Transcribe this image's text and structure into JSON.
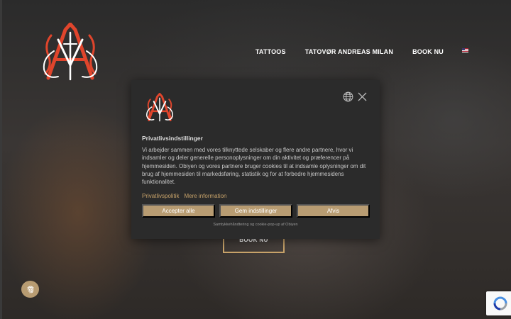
{
  "brand": {
    "logo_icon": "am-monogram-logo-icon",
    "accent": "#c8a36a",
    "logo_red": "#e0452c"
  },
  "nav": {
    "items": [
      {
        "label": "TATTOOS"
      },
      {
        "label": "TATOVØR ANDREAS MILAN"
      },
      {
        "label": "BOOK NU"
      }
    ],
    "flag_icon": "us-flag-icon"
  },
  "hero": {
    "button_label": "BOOK NU"
  },
  "consent": {
    "logo_icon": "am-monogram-logo-icon",
    "globe_icon": "globe-icon",
    "close_icon": "close-icon",
    "title": "Privatlivsindstillinger",
    "text": "Vi arbejder sammen med vores tilknyttede selskaber og flere andre partnere, hvor vi indsamler og deler generelle personoplysninger om din aktivitet og præferencer på hjemmesiden. Obiyen og vores partnere bruger cookies til at indsamle oplysninger om dit brug af hjemmesiden til markedsføring, statistik og for at forbedre hjemmesidens funktionalitet.",
    "links": [
      {
        "label": "Privatlivspolitik"
      },
      {
        "label": "Mere information"
      }
    ],
    "buttons": [
      {
        "label": "Accepter alle"
      },
      {
        "label": "Gem indstillinger"
      },
      {
        "label": "Afvis"
      }
    ],
    "footer": "Samtykkehåndtering og cookie-pop-up af Obiyen"
  },
  "floating": {
    "fingerprint_icon": "fingerprint-icon",
    "recaptcha_icon": "recaptcha-icon"
  }
}
